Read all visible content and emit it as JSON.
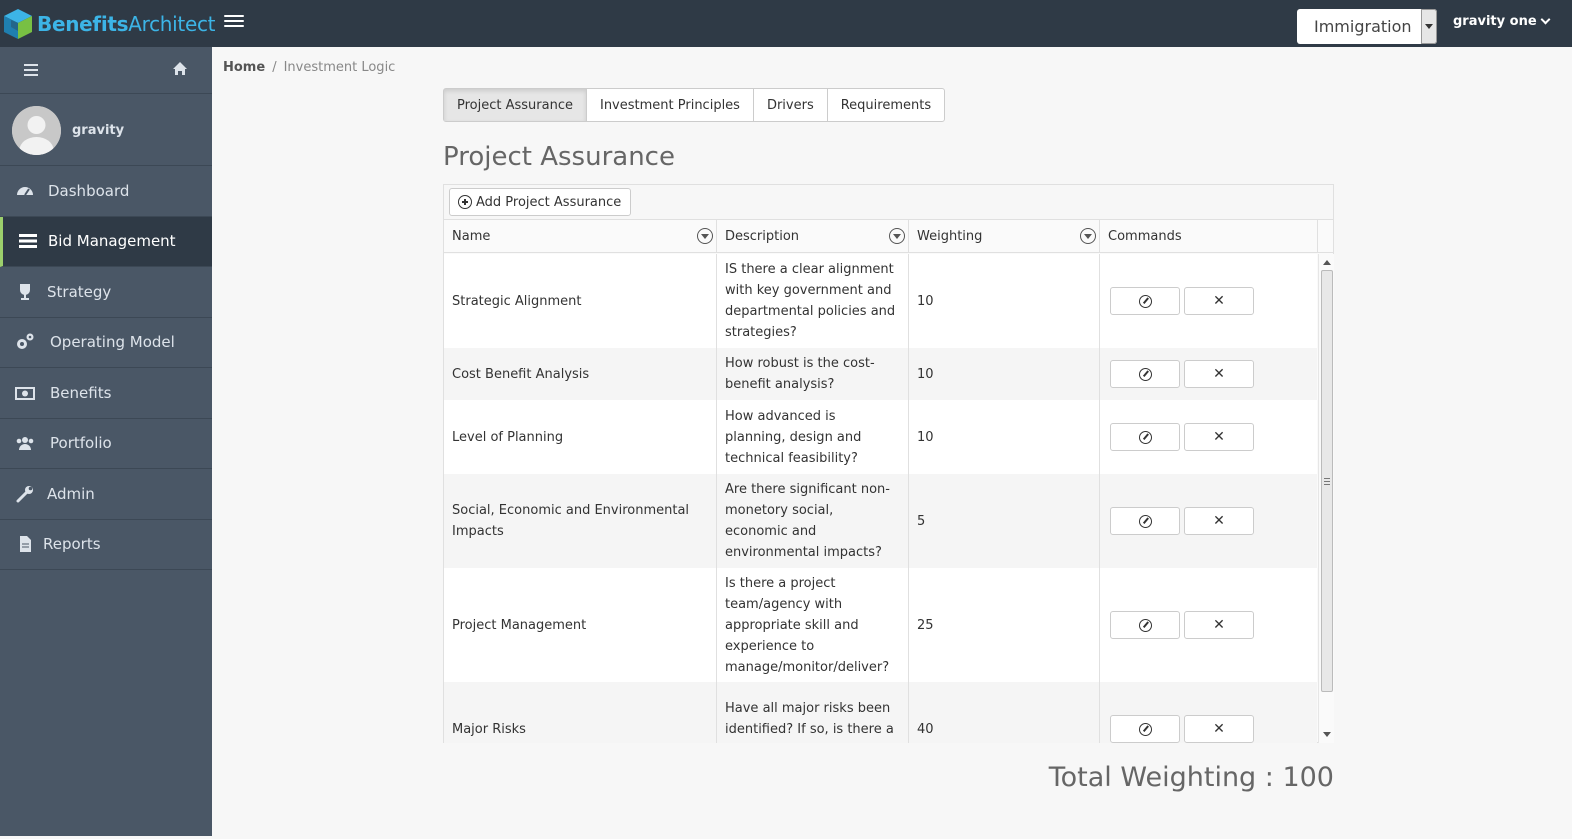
{
  "app": {
    "logo_text_bold": "Benefits",
    "logo_text_light": "Architect",
    "project_selector": "Immigration",
    "user_menu": "gravity one"
  },
  "sidebar": {
    "username": "gravity",
    "items": [
      {
        "label": "Dashboard",
        "icon": "dashboard-icon"
      },
      {
        "label": "Bid Management",
        "icon": "tasks-icon",
        "active": true
      },
      {
        "label": "Strategy",
        "icon": "trophy-icon"
      },
      {
        "label": "Operating Model",
        "icon": "cogs-icon"
      },
      {
        "label": "Benefits",
        "icon": "money-icon"
      },
      {
        "label": "Portfolio",
        "icon": "users-icon"
      },
      {
        "label": "Admin",
        "icon": "wrench-icon"
      },
      {
        "label": "Reports",
        "icon": "file-icon"
      }
    ]
  },
  "breadcrumb": {
    "home": "Home",
    "separator": "/",
    "current": "Investment Logic"
  },
  "tabs": [
    {
      "label": "Project Assurance",
      "active": true
    },
    {
      "label": "Investment Principles"
    },
    {
      "label": "Drivers"
    },
    {
      "label": "Requirements"
    }
  ],
  "page": {
    "title": "Project Assurance",
    "add_button": "Add Project Assurance",
    "total_label": "Total Weighting : 100"
  },
  "table": {
    "columns": [
      "Name",
      "Description",
      "Weighting",
      "Commands"
    ],
    "rows": [
      {
        "name": "Strategic Alignment",
        "description": "IS there a clear alignment with key government and departmental policies and strategies?",
        "weighting": "10"
      },
      {
        "name": "Cost Benefit Analysis",
        "description": "How robust is the cost-benefit analysis?",
        "weighting": "10"
      },
      {
        "name": "Level of Planning",
        "description": "How advanced is planning, design and technical feasibility?",
        "weighting": "10"
      },
      {
        "name": "Social, Economic and Environmental Impacts",
        "description": "Are there significant non-monetory social, economic and environmental impacts?",
        "weighting": "5"
      },
      {
        "name": "Project Management",
        "description": "Is there a project team/agency with appropriate skill and experience to manage/monitor/deliver?",
        "weighting": "25"
      },
      {
        "name": "Major Risks",
        "description": "Have all major risks been identified? If so, is there a strategy to mitigate major",
        "weighting": "40"
      }
    ]
  },
  "colors": {
    "topbar": "#2f3a46",
    "sidebar": "#4a5766",
    "logo_accent": "#3cb4e6",
    "active_indicator": "#9ccf6c"
  }
}
